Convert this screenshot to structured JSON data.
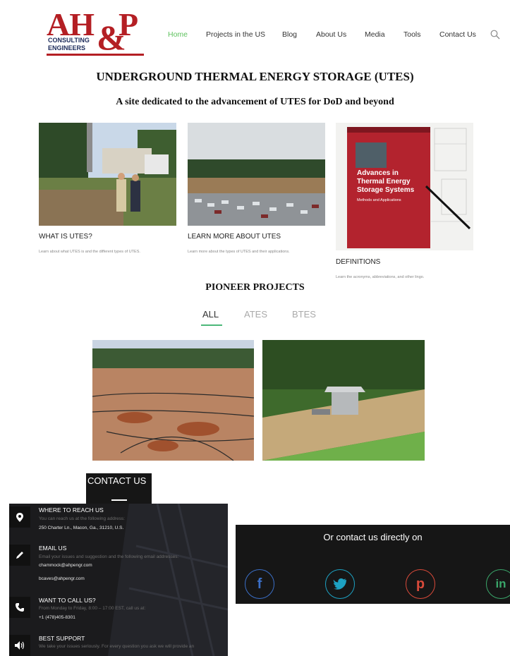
{
  "header": {
    "logo": {
      "letters_left": "AH",
      "ampersand": "&",
      "letters_right": "P",
      "sub_line1": "CONSULTING",
      "sub_line2": "ENGINEERS"
    },
    "nav": [
      "Home",
      "Projects in the US",
      "Blog",
      "About Us",
      "Media",
      "Tools",
      "Contact Us"
    ],
    "active_nav": "Home",
    "search_icon": "search-icon"
  },
  "hero": {
    "title": "UNDERGROUND THERMAL ENERGY STORAGE (UTES)",
    "subtitle": "A site dedicated to the advancement of UTES for DoD and beyond"
  },
  "cards": [
    {
      "title": "WHAT IS UTES?",
      "desc": "Learn about what UTES is and the different types of UTES."
    },
    {
      "title": "LEARN MORE ABOUT UTES",
      "desc": "Learn more about the types of UTES and their applications."
    },
    {
      "title": "DEFINITIONS",
      "desc": "Learn the acronyms, abbreviations, and other lingo.",
      "book": {
        "line1": "Advances in",
        "line2": "Thermal Energy",
        "line3": "Storage Systems",
        "line4": "Methods and Applications"
      }
    }
  ],
  "projects": {
    "title": "PIONEER PROJECTS",
    "filters": [
      "ALL",
      "ATES",
      "BTES"
    ],
    "active_filter": "ALL"
  },
  "contact": {
    "tab_label": "CONTACT US",
    "rows": [
      {
        "icon": "map-pin-icon",
        "heading": "WHERE TO REACH US",
        "desc": "You can reach us at the following address:",
        "values": [
          "250 Charter Ln., Macon, Ga., 31210, U.S."
        ]
      },
      {
        "icon": "pencil-icon",
        "heading": "EMAIL US",
        "desc": "Email your issues and suggestion and the following email addresses:",
        "values": [
          "chammock@ahpengr.com",
          "bcaves@ahpengr.com"
        ]
      },
      {
        "icon": "phone-icon",
        "heading": "WANT TO CALL US?",
        "desc": "From Monday to Friday, 8:00 – 17:00 EST, call us at:",
        "values": [
          "+1 (478)405-8301"
        ]
      },
      {
        "icon": "speaker-icon",
        "heading": "BEST SUPPORT",
        "desc": "We take your issues seriously. For every question you ask we will provide an",
        "values": []
      }
    ],
    "direct_title": "Or contact us directly on",
    "social": [
      {
        "icon": "facebook-icon",
        "glyph": "f",
        "color": "#3b6fc7"
      },
      {
        "icon": "twitter-icon",
        "glyph": "",
        "color": "#1da1c2"
      },
      {
        "icon": "pinterest-icon",
        "glyph": "p",
        "color": "#d84a3a"
      },
      {
        "icon": "linkedin-icon",
        "glyph": "in",
        "color": "#3aa66a"
      }
    ]
  }
}
